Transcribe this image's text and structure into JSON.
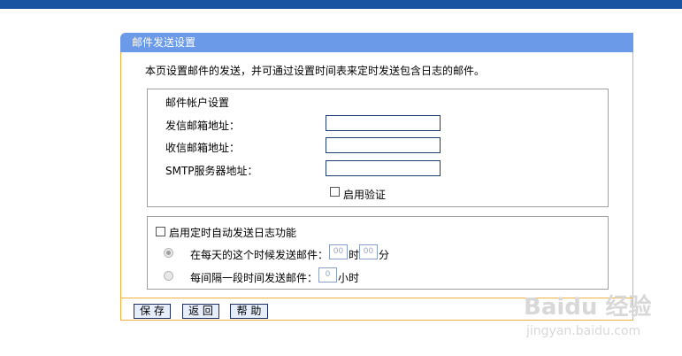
{
  "panel": {
    "title": "邮件发送设置",
    "intro": "本页设置邮件的发送，并可通过设置时间表来定时发送包含日志的邮件。"
  },
  "account": {
    "legend": "邮件帐户设置",
    "from_label": "发信邮箱地址：",
    "from_value": "",
    "to_label": "收信邮箱地址：",
    "to_value": "",
    "smtp_label": "SMTP服务器地址：",
    "smtp_value": "",
    "auth_label": "启用验证",
    "auth_checked": false
  },
  "schedule": {
    "enable_label": "启用定时自动发送日志功能",
    "enable_checked": false,
    "daily_label": "在每天的这个时候发送邮件：",
    "hour_value": "00",
    "hour_unit": "时",
    "minute_value": "00",
    "minute_unit": "分",
    "interval_label": "每间隔一段时间发送邮件：",
    "interval_value": "0",
    "interval_unit": "小时",
    "selected_option": "daily"
  },
  "buttons": {
    "save": "保 存",
    "back": "返 回",
    "help": "帮 助"
  },
  "watermark": {
    "brand": "Baidu 经验",
    "url": "jingyan.baidu.com"
  }
}
